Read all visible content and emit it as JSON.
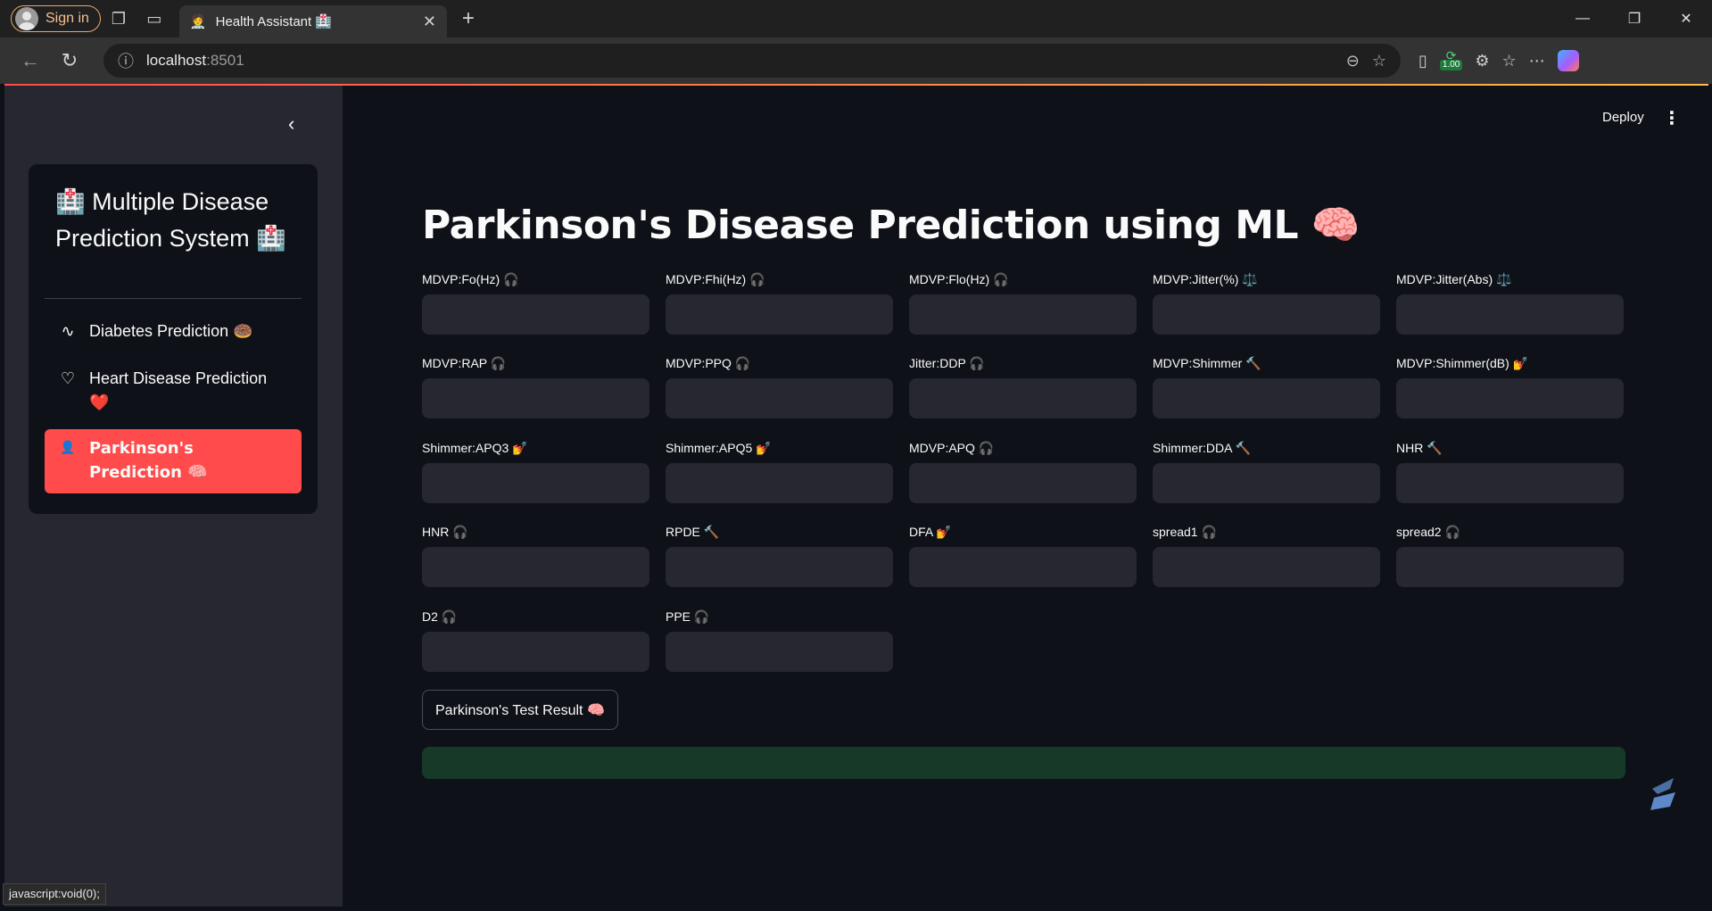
{
  "browser": {
    "sign_in": "Sign in",
    "tab_title": "Health Assistant 🏥",
    "tab_favicon": "🧑‍⚕️",
    "address_host": "localhost",
    "address_port": ":8501",
    "zoom_badge": "1.00",
    "status_url": "javascript:void(0);"
  },
  "header": {
    "deploy": "Deploy",
    "menu": "⋮"
  },
  "sidebar": {
    "collapse": "‹",
    "app_title": "🏥 Multiple Disease Prediction System 🏥",
    "items": [
      {
        "icon": "∿",
        "label": "Diabetes Prediction 🍩",
        "active": false
      },
      {
        "icon": "♡",
        "label": "Heart Disease Prediction ❤️",
        "active": false
      },
      {
        "icon": "👤",
        "label": "Parkinson's Prediction 🧠",
        "active": true
      }
    ]
  },
  "main": {
    "title": "Parkinson's Disease Prediction using ML 🧠",
    "fields": [
      "MDVP:Fo(Hz) 🎧",
      "MDVP:Fhi(Hz) 🎧",
      "MDVP:Flo(Hz) 🎧",
      "MDVP:Jitter(%) ⚖️",
      "MDVP:Jitter(Abs) ⚖️",
      "MDVP:RAP 🎧",
      "MDVP:PPQ 🎧",
      "Jitter:DDP 🎧",
      "MDVP:Shimmer 🔨",
      "MDVP:Shimmer(dB) 💅",
      "Shimmer:APQ3 💅",
      "Shimmer:APQ5 💅",
      "MDVP:APQ 🎧",
      "Shimmer:DDA 🔨",
      "NHR 🔨",
      "HNR 🎧",
      "RPDE 🔨",
      "DFA 💅",
      "spread1 🎧",
      "spread2 🎧",
      "D2 🎧",
      "PPE 🎧"
    ],
    "button": "Parkinson's Test Result 🧠",
    "result_text": ""
  },
  "colors": {
    "accent": "#ff4b4b",
    "background": "#0e1117",
    "sidebar": "#262730",
    "input": "#262730",
    "success": "#173928"
  }
}
